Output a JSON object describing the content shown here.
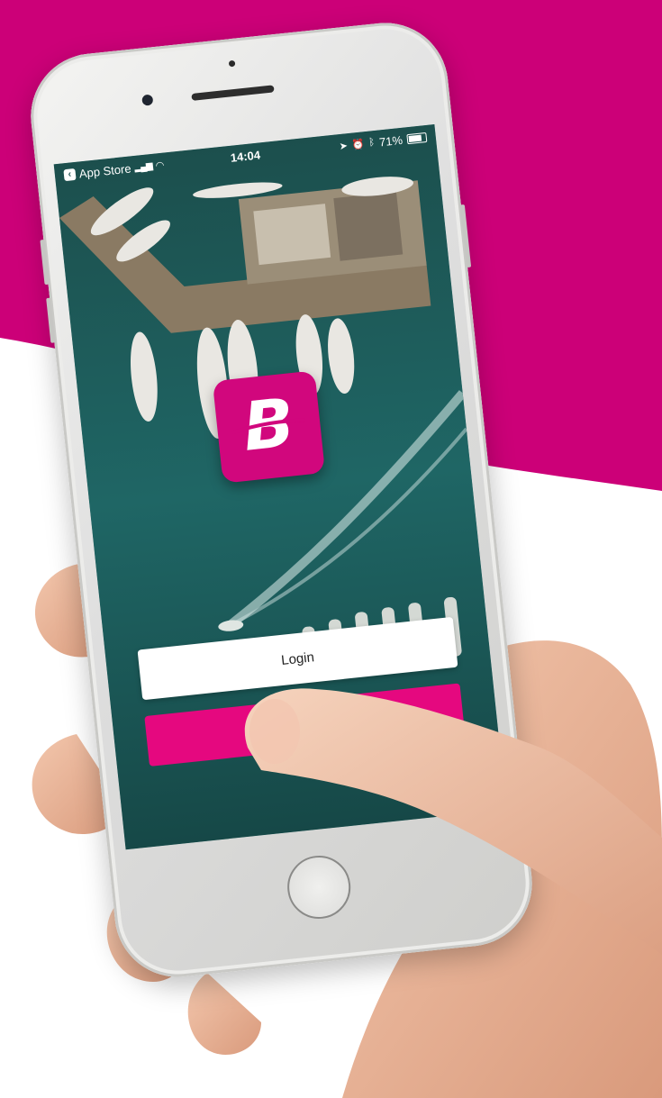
{
  "colors": {
    "brand_pink": "#cc0078",
    "button_pink": "#e5087f",
    "sea": "#1d5d5c"
  },
  "status_bar": {
    "back_app": "App Store",
    "time": "14:04",
    "battery": "71%",
    "battery_level": 0.71,
    "icons": [
      "back-arrow-icon",
      "signal-icon",
      "wifi-icon",
      "location-icon",
      "alarm-icon",
      "bluetooth-icon",
      "battery-icon"
    ]
  },
  "app": {
    "logo_letter": "B"
  },
  "buttons": {
    "login_label": "Login"
  }
}
